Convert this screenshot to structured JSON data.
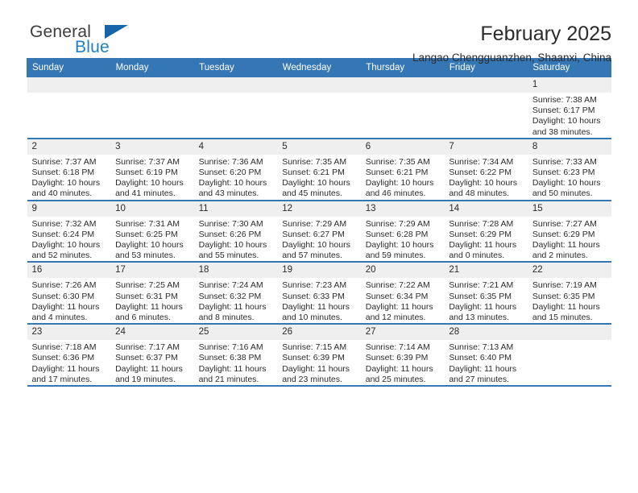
{
  "brand": {
    "name_part1": "General",
    "name_part2": "Blue",
    "flag_icon": "blue-triangle-flag-icon"
  },
  "header": {
    "title": "February 2025",
    "subtitle": "Langao Chengguanzhen, Shaanxi, China"
  },
  "colors": {
    "header_blue": "#3576b5",
    "brand_blue": "#1f7fc4",
    "daynum_strip": "#efefef",
    "text": "#2b2b2b"
  },
  "weekdays": [
    "Sunday",
    "Monday",
    "Tuesday",
    "Wednesday",
    "Thursday",
    "Friday",
    "Saturday"
  ],
  "weeks": [
    [
      {
        "day": "",
        "sunrise": "",
        "sunset": "",
        "daylight": "",
        "empty": true
      },
      {
        "day": "",
        "sunrise": "",
        "sunset": "",
        "daylight": "",
        "empty": true
      },
      {
        "day": "",
        "sunrise": "",
        "sunset": "",
        "daylight": "",
        "empty": true
      },
      {
        "day": "",
        "sunrise": "",
        "sunset": "",
        "daylight": "",
        "empty": true
      },
      {
        "day": "",
        "sunrise": "",
        "sunset": "",
        "daylight": "",
        "empty": true
      },
      {
        "day": "",
        "sunrise": "",
        "sunset": "",
        "daylight": "",
        "empty": true
      },
      {
        "day": "1",
        "sunrise": "Sunrise: 7:38 AM",
        "sunset": "Sunset: 6:17 PM",
        "daylight": "Daylight: 10 hours and 38 minutes.",
        "empty": false
      }
    ],
    [
      {
        "day": "2",
        "sunrise": "Sunrise: 7:37 AM",
        "sunset": "Sunset: 6:18 PM",
        "daylight": "Daylight: 10 hours and 40 minutes.",
        "empty": false
      },
      {
        "day": "3",
        "sunrise": "Sunrise: 7:37 AM",
        "sunset": "Sunset: 6:19 PM",
        "daylight": "Daylight: 10 hours and 41 minutes.",
        "empty": false
      },
      {
        "day": "4",
        "sunrise": "Sunrise: 7:36 AM",
        "sunset": "Sunset: 6:20 PM",
        "daylight": "Daylight: 10 hours and 43 minutes.",
        "empty": false
      },
      {
        "day": "5",
        "sunrise": "Sunrise: 7:35 AM",
        "sunset": "Sunset: 6:21 PM",
        "daylight": "Daylight: 10 hours and 45 minutes.",
        "empty": false
      },
      {
        "day": "6",
        "sunrise": "Sunrise: 7:35 AM",
        "sunset": "Sunset: 6:21 PM",
        "daylight": "Daylight: 10 hours and 46 minutes.",
        "empty": false
      },
      {
        "day": "7",
        "sunrise": "Sunrise: 7:34 AM",
        "sunset": "Sunset: 6:22 PM",
        "daylight": "Daylight: 10 hours and 48 minutes.",
        "empty": false
      },
      {
        "day": "8",
        "sunrise": "Sunrise: 7:33 AM",
        "sunset": "Sunset: 6:23 PM",
        "daylight": "Daylight: 10 hours and 50 minutes.",
        "empty": false
      }
    ],
    [
      {
        "day": "9",
        "sunrise": "Sunrise: 7:32 AM",
        "sunset": "Sunset: 6:24 PM",
        "daylight": "Daylight: 10 hours and 52 minutes.",
        "empty": false
      },
      {
        "day": "10",
        "sunrise": "Sunrise: 7:31 AM",
        "sunset": "Sunset: 6:25 PM",
        "daylight": "Daylight: 10 hours and 53 minutes.",
        "empty": false
      },
      {
        "day": "11",
        "sunrise": "Sunrise: 7:30 AM",
        "sunset": "Sunset: 6:26 PM",
        "daylight": "Daylight: 10 hours and 55 minutes.",
        "empty": false
      },
      {
        "day": "12",
        "sunrise": "Sunrise: 7:29 AM",
        "sunset": "Sunset: 6:27 PM",
        "daylight": "Daylight: 10 hours and 57 minutes.",
        "empty": false
      },
      {
        "day": "13",
        "sunrise": "Sunrise: 7:29 AM",
        "sunset": "Sunset: 6:28 PM",
        "daylight": "Daylight: 10 hours and 59 minutes.",
        "empty": false
      },
      {
        "day": "14",
        "sunrise": "Sunrise: 7:28 AM",
        "sunset": "Sunset: 6:29 PM",
        "daylight": "Daylight: 11 hours and 0 minutes.",
        "empty": false
      },
      {
        "day": "15",
        "sunrise": "Sunrise: 7:27 AM",
        "sunset": "Sunset: 6:29 PM",
        "daylight": "Daylight: 11 hours and 2 minutes.",
        "empty": false
      }
    ],
    [
      {
        "day": "16",
        "sunrise": "Sunrise: 7:26 AM",
        "sunset": "Sunset: 6:30 PM",
        "daylight": "Daylight: 11 hours and 4 minutes.",
        "empty": false
      },
      {
        "day": "17",
        "sunrise": "Sunrise: 7:25 AM",
        "sunset": "Sunset: 6:31 PM",
        "daylight": "Daylight: 11 hours and 6 minutes.",
        "empty": false
      },
      {
        "day": "18",
        "sunrise": "Sunrise: 7:24 AM",
        "sunset": "Sunset: 6:32 PM",
        "daylight": "Daylight: 11 hours and 8 minutes.",
        "empty": false
      },
      {
        "day": "19",
        "sunrise": "Sunrise: 7:23 AM",
        "sunset": "Sunset: 6:33 PM",
        "daylight": "Daylight: 11 hours and 10 minutes.",
        "empty": false
      },
      {
        "day": "20",
        "sunrise": "Sunrise: 7:22 AM",
        "sunset": "Sunset: 6:34 PM",
        "daylight": "Daylight: 11 hours and 12 minutes.",
        "empty": false
      },
      {
        "day": "21",
        "sunrise": "Sunrise: 7:21 AM",
        "sunset": "Sunset: 6:35 PM",
        "daylight": "Daylight: 11 hours and 13 minutes.",
        "empty": false
      },
      {
        "day": "22",
        "sunrise": "Sunrise: 7:19 AM",
        "sunset": "Sunset: 6:35 PM",
        "daylight": "Daylight: 11 hours and 15 minutes.",
        "empty": false
      }
    ],
    [
      {
        "day": "23",
        "sunrise": "Sunrise: 7:18 AM",
        "sunset": "Sunset: 6:36 PM",
        "daylight": "Daylight: 11 hours and 17 minutes.",
        "empty": false
      },
      {
        "day": "24",
        "sunrise": "Sunrise: 7:17 AM",
        "sunset": "Sunset: 6:37 PM",
        "daylight": "Daylight: 11 hours and 19 minutes.",
        "empty": false
      },
      {
        "day": "25",
        "sunrise": "Sunrise: 7:16 AM",
        "sunset": "Sunset: 6:38 PM",
        "daylight": "Daylight: 11 hours and 21 minutes.",
        "empty": false
      },
      {
        "day": "26",
        "sunrise": "Sunrise: 7:15 AM",
        "sunset": "Sunset: 6:39 PM",
        "daylight": "Daylight: 11 hours and 23 minutes.",
        "empty": false
      },
      {
        "day": "27",
        "sunrise": "Sunrise: 7:14 AM",
        "sunset": "Sunset: 6:39 PM",
        "daylight": "Daylight: 11 hours and 25 minutes.",
        "empty": false
      },
      {
        "day": "28",
        "sunrise": "Sunrise: 7:13 AM",
        "sunset": "Sunset: 6:40 PM",
        "daylight": "Daylight: 11 hours and 27 minutes.",
        "empty": false
      },
      {
        "day": "",
        "sunrise": "",
        "sunset": "",
        "daylight": "",
        "empty": true
      }
    ]
  ]
}
